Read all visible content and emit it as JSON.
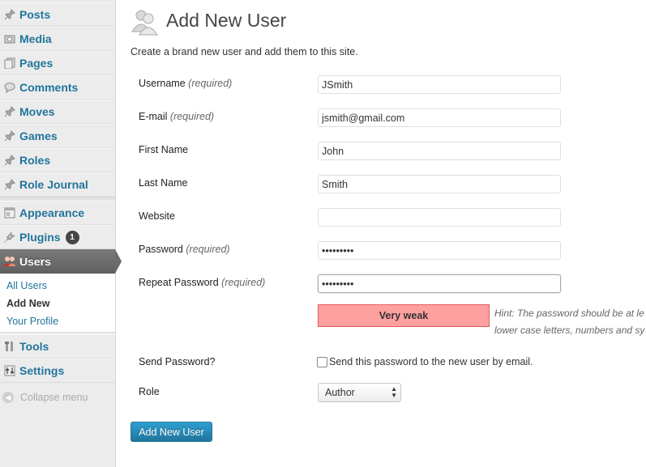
{
  "sidebar": {
    "items": [
      {
        "label": "Posts",
        "icon": "pin-icon"
      },
      {
        "label": "Media",
        "icon": "media-icon"
      },
      {
        "label": "Pages",
        "icon": "pages-icon"
      },
      {
        "label": "Comments",
        "icon": "comment-icon"
      },
      {
        "label": "Moves",
        "icon": "pin-icon"
      },
      {
        "label": "Games",
        "icon": "pin-icon"
      },
      {
        "label": "Roles",
        "icon": "pin-icon"
      },
      {
        "label": "Role Journal",
        "icon": "pin-icon"
      },
      {
        "label": "Appearance",
        "icon": "appearance-icon"
      },
      {
        "label": "Plugins",
        "icon": "plugin-icon",
        "badge": "1"
      },
      {
        "label": "Users",
        "icon": "users-icon"
      },
      {
        "label": "Tools",
        "icon": "tools-icon"
      },
      {
        "label": "Settings",
        "icon": "settings-icon"
      }
    ],
    "submenu": [
      "All Users",
      "Add New",
      "Your Profile"
    ],
    "collapse_label": "Collapse menu"
  },
  "page": {
    "title": "Add New User",
    "intro": "Create a brand new user and add them to this site."
  },
  "form": {
    "username": {
      "label": "Username",
      "req": "(required)",
      "value": "JSmith"
    },
    "email": {
      "label": "E-mail",
      "req": "(required)",
      "value": "jsmith@gmail.com"
    },
    "first_name": {
      "label": "First Name",
      "value": "John"
    },
    "last_name": {
      "label": "Last Name",
      "value": "Smith"
    },
    "website": {
      "label": "Website",
      "value": ""
    },
    "password": {
      "label": "Password",
      "req": "(required)",
      "value": "•••••••••"
    },
    "repeat_password": {
      "label": "Repeat Password",
      "req": "(required)",
      "value": "•••••••••"
    },
    "strength": "Very weak",
    "hint_line1": "Hint: The password should be at le",
    "hint_line2": "lower case letters, numbers and sy",
    "send_password": {
      "label": "Send Password?",
      "checkbox_label": "Send this password to the new user by email.",
      "checked": false
    },
    "role": {
      "label": "Role",
      "value": "Author"
    },
    "submit_label": "Add New User"
  },
  "colors": {
    "link": "#21759b",
    "strength_bg": "#ffa0a0",
    "button": "#21759b"
  }
}
